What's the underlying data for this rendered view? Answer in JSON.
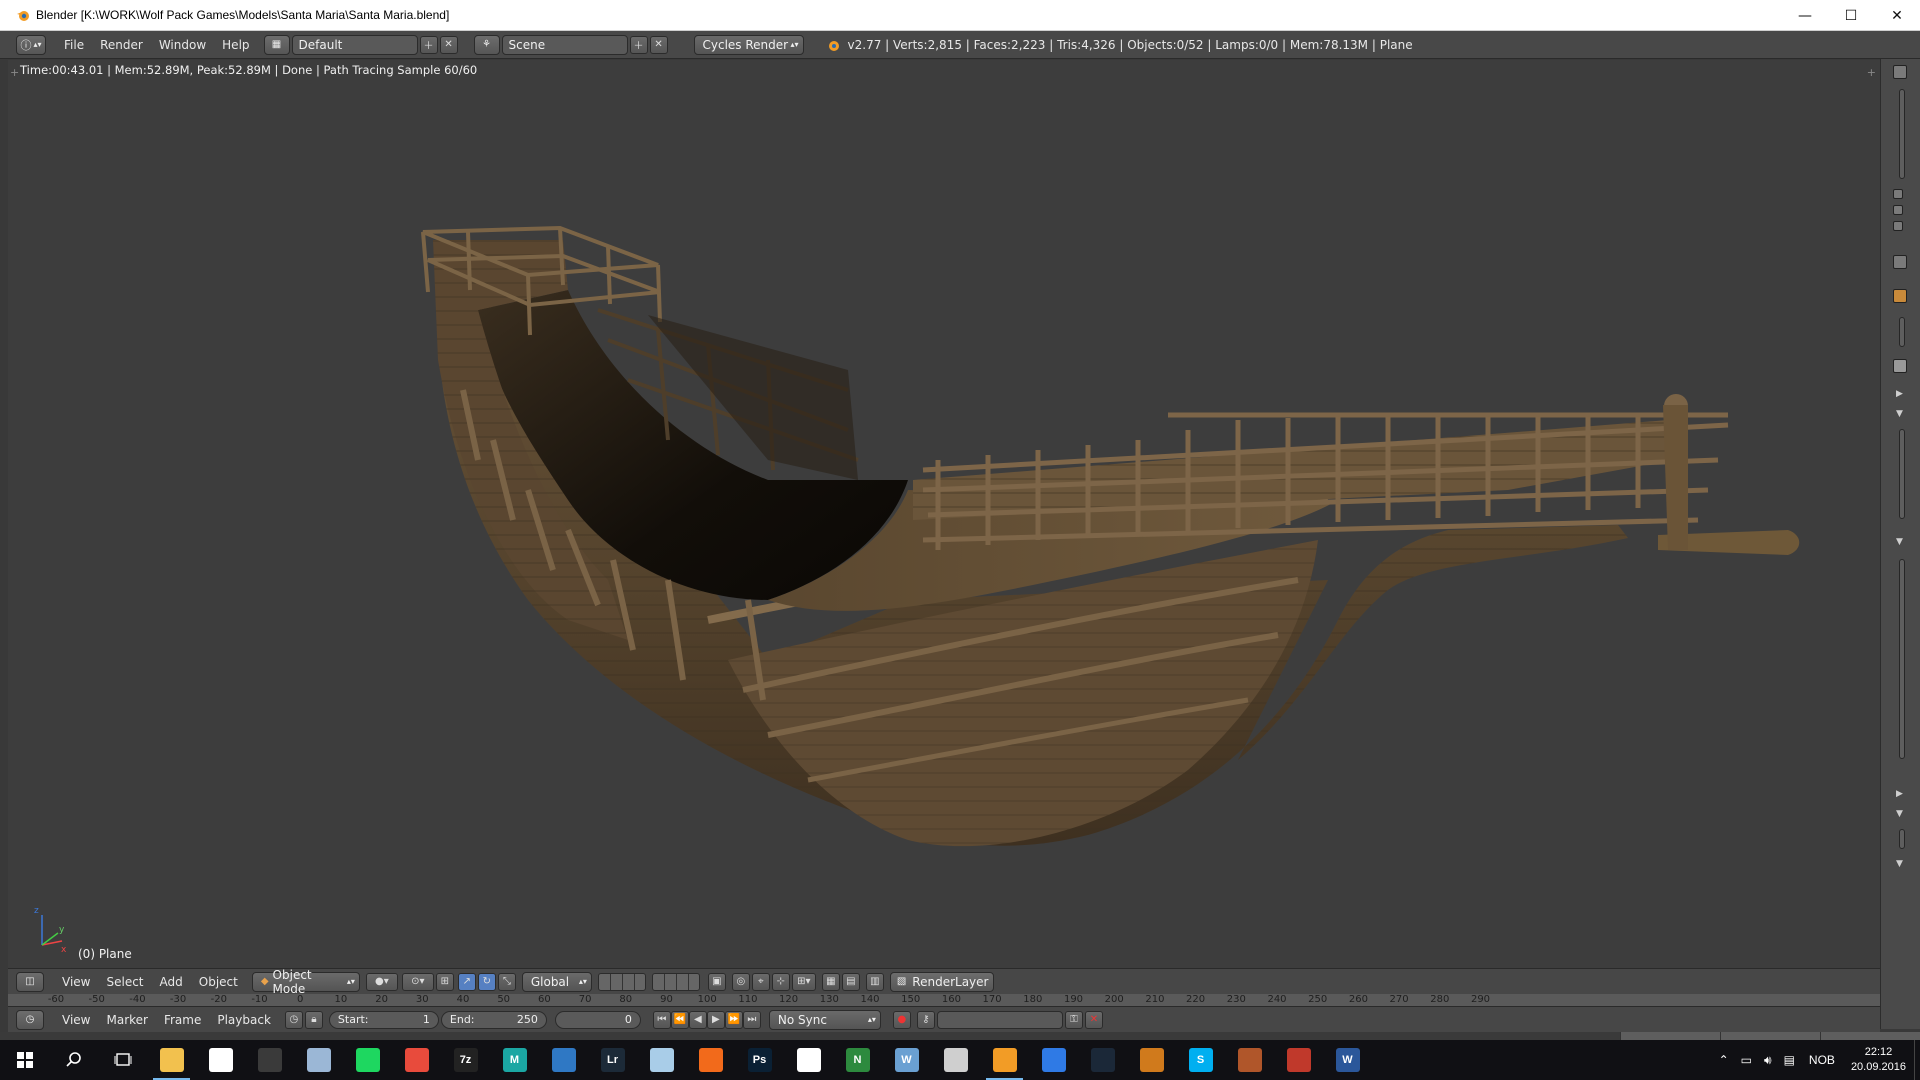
{
  "window": {
    "title": "Blender [K:\\WORK\\Wolf Pack Games\\Models\\Santa Maria\\Santa Maria.blend]",
    "minimize": "—",
    "maximize": "☐",
    "close": "✕"
  },
  "info_header": {
    "menus": [
      "File",
      "Render",
      "Window",
      "Help"
    ],
    "screen_layout": "Default",
    "scene": "Scene",
    "render_engine": "Cycles Render",
    "stats": "v2.77 | Verts:2,815 | Faces:2,223 | Tris:4,326 | Objects:0/52 | Lamps:0/0 | Mem:78.13M | Plane"
  },
  "viewport": {
    "render_status": "Time:00:43.01 | Mem:52.89M, Peak:52.89M | Done | Path Tracing Sample 60/60",
    "object_label": "(0) Plane",
    "axis_x": "x",
    "axis_y": "y",
    "axis_z": "z"
  },
  "view3d_header": {
    "menus": [
      "View",
      "Select",
      "Add",
      "Object"
    ],
    "mode": "Object Mode",
    "orientation": "Global",
    "render_layer": "RenderLayer"
  },
  "timeline": {
    "ticks": [
      "-60",
      "-50",
      "-40",
      "-30",
      "-20",
      "-10",
      "0",
      "10",
      "20",
      "30",
      "40",
      "50",
      "60",
      "70",
      "80",
      "90",
      "100",
      "110",
      "120",
      "130",
      "140",
      "150",
      "160",
      "170",
      "180",
      "190",
      "200",
      "210",
      "220",
      "230",
      "240",
      "250",
      "260",
      "270",
      "280",
      "290"
    ],
    "menus": [
      "View",
      "Marker",
      "Frame",
      "Playback"
    ],
    "start_label": "Start:",
    "start_value": "1",
    "end_label": "End:",
    "end_value": "250",
    "current_frame": "0",
    "sync": "No Sync"
  },
  "taskbar": {
    "apps": [
      {
        "name": "file-explorer",
        "color": "#f2c14e",
        "glyph": "",
        "active": true
      },
      {
        "name": "store",
        "color": "#ffffff",
        "glyph": "",
        "active": false
      },
      {
        "name": "headset-app",
        "color": "#3a3a3a",
        "glyph": "",
        "active": false
      },
      {
        "name": "feather-app",
        "color": "#9bb7d6",
        "glyph": "",
        "active": false
      },
      {
        "name": "spotify",
        "color": "#1ed760",
        "glyph": "",
        "active": false
      },
      {
        "name": "chrome",
        "color": "#e84b3c",
        "glyph": "",
        "active": false
      },
      {
        "name": "7zip",
        "color": "#222222",
        "glyph": "7z",
        "active": false
      },
      {
        "name": "maya",
        "color": "#1ba7a3",
        "glyph": "M",
        "active": false
      },
      {
        "name": "crayon-app",
        "color": "#2f78c4",
        "glyph": "",
        "active": false
      },
      {
        "name": "lightroom",
        "color": "#1c2a38",
        "glyph": "Lr",
        "active": false
      },
      {
        "name": "paper-app",
        "color": "#a9cde8",
        "glyph": "",
        "active": false
      },
      {
        "name": "origin",
        "color": "#f26a1b",
        "glyph": "",
        "active": false
      },
      {
        "name": "photoshop",
        "color": "#0a2034",
        "glyph": "Ps",
        "active": false
      },
      {
        "name": "eye-app",
        "color": "#ffffff",
        "glyph": "",
        "active": false
      },
      {
        "name": "n-app",
        "color": "#2d8a3e",
        "glyph": "N",
        "active": false
      },
      {
        "name": "wordpress",
        "color": "#6aa0d2",
        "glyph": "W",
        "active": false
      },
      {
        "name": "krita",
        "color": "#cfcfcf",
        "glyph": "",
        "active": false
      },
      {
        "name": "blender",
        "color": "#f29c26",
        "glyph": "",
        "active": true
      },
      {
        "name": "window-app",
        "color": "#2f7ae5",
        "glyph": "",
        "active": false
      },
      {
        "name": "steam",
        "color": "#1b2838",
        "glyph": "",
        "active": false
      },
      {
        "name": "reaper",
        "color": "#d07a1c",
        "glyph": "",
        "active": false
      },
      {
        "name": "skype",
        "color": "#00aff0",
        "glyph": "S",
        "active": false
      },
      {
        "name": "game-app",
        "color": "#b0562a",
        "glyph": "",
        "active": false
      },
      {
        "name": "brush-app",
        "color": "#c0392b",
        "glyph": "",
        "active": false
      },
      {
        "name": "word",
        "color": "#2b579a",
        "glyph": "W",
        "active": false
      }
    ],
    "language": "NOB",
    "time": "22:12",
    "date": "20.09.2016"
  }
}
